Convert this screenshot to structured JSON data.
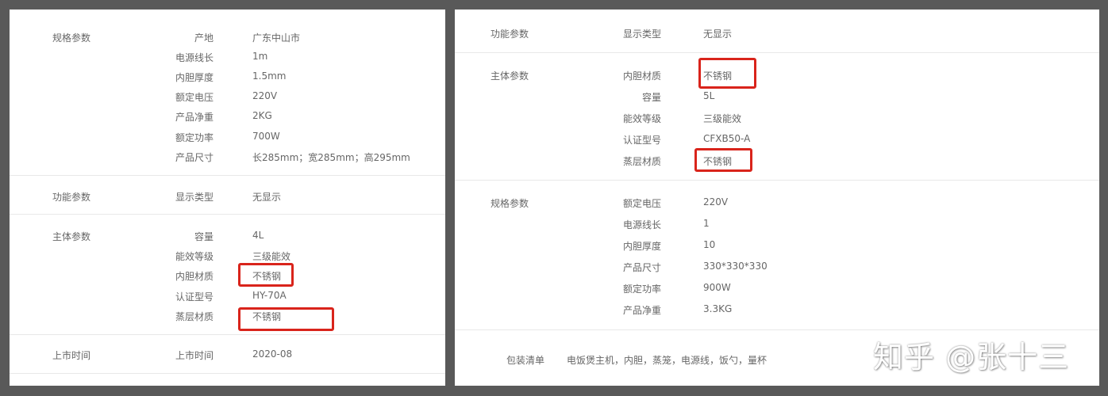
{
  "left_panel": {
    "spec": {
      "category": "规格参数",
      "rows": [
        {
          "name": "产地",
          "value": "广东中山市"
        },
        {
          "name": "电源线长",
          "value": "1m"
        },
        {
          "name": "内胆厚度",
          "value": "1.5mm"
        },
        {
          "name": "额定电压",
          "value": "220V"
        },
        {
          "name": "产品净重",
          "value": "2KG"
        },
        {
          "name": "额定功率",
          "value": "700W"
        },
        {
          "name": "产品尺寸",
          "value": "长285mm；宽285mm；高295mm"
        }
      ]
    },
    "function": {
      "category": "功能参数",
      "rows": [
        {
          "name": "显示类型",
          "value": "无显示"
        }
      ]
    },
    "body": {
      "category": "主体参数",
      "rows": [
        {
          "name": "容量",
          "value": "4L"
        },
        {
          "name": "能效等级",
          "value": "三级能效"
        },
        {
          "name": "内胆材质",
          "value": "不锈钢"
        },
        {
          "name": "认证型号",
          "value": "HY-70A"
        },
        {
          "name": "蒸层材质",
          "value": "不锈钢"
        }
      ]
    },
    "launch": {
      "category": "上市时间",
      "rows": [
        {
          "name": "上市时间",
          "value": "2020-08"
        }
      ]
    }
  },
  "right_panel": {
    "function": {
      "category": "功能参数",
      "rows": [
        {
          "name": "显示类型",
          "value": "无显示"
        }
      ]
    },
    "body": {
      "category": "主体参数",
      "rows": [
        {
          "name": "内胆材质",
          "value": "不锈钢"
        },
        {
          "name": "容量",
          "value": "5L"
        },
        {
          "name": "能效等级",
          "value": "三级能效"
        },
        {
          "name": "认证型号",
          "value": "CFXB50-A"
        },
        {
          "name": "蒸层材质",
          "value": "不锈钢"
        }
      ]
    },
    "spec": {
      "category": "规格参数",
      "rows": [
        {
          "name": "额定电压",
          "value": "220V"
        },
        {
          "name": "电源线长",
          "value": "1"
        },
        {
          "name": "内胆厚度",
          "value": "10"
        },
        {
          "name": "产品尺寸",
          "value": "330*330*330"
        },
        {
          "name": "额定功率",
          "value": "900W"
        },
        {
          "name": "产品净重",
          "value": "3.3KG"
        }
      ]
    },
    "package": {
      "label": "包装清单",
      "value": "电饭煲主机，内胆，蒸笼，电源线，饭勺，量杯"
    }
  },
  "watermark": "知乎 @张十三",
  "colors": {
    "background": "#595959",
    "panel": "#ffffff",
    "text": "#666666",
    "highlight": "#d9241b",
    "divider": "#e8e8e8"
  }
}
